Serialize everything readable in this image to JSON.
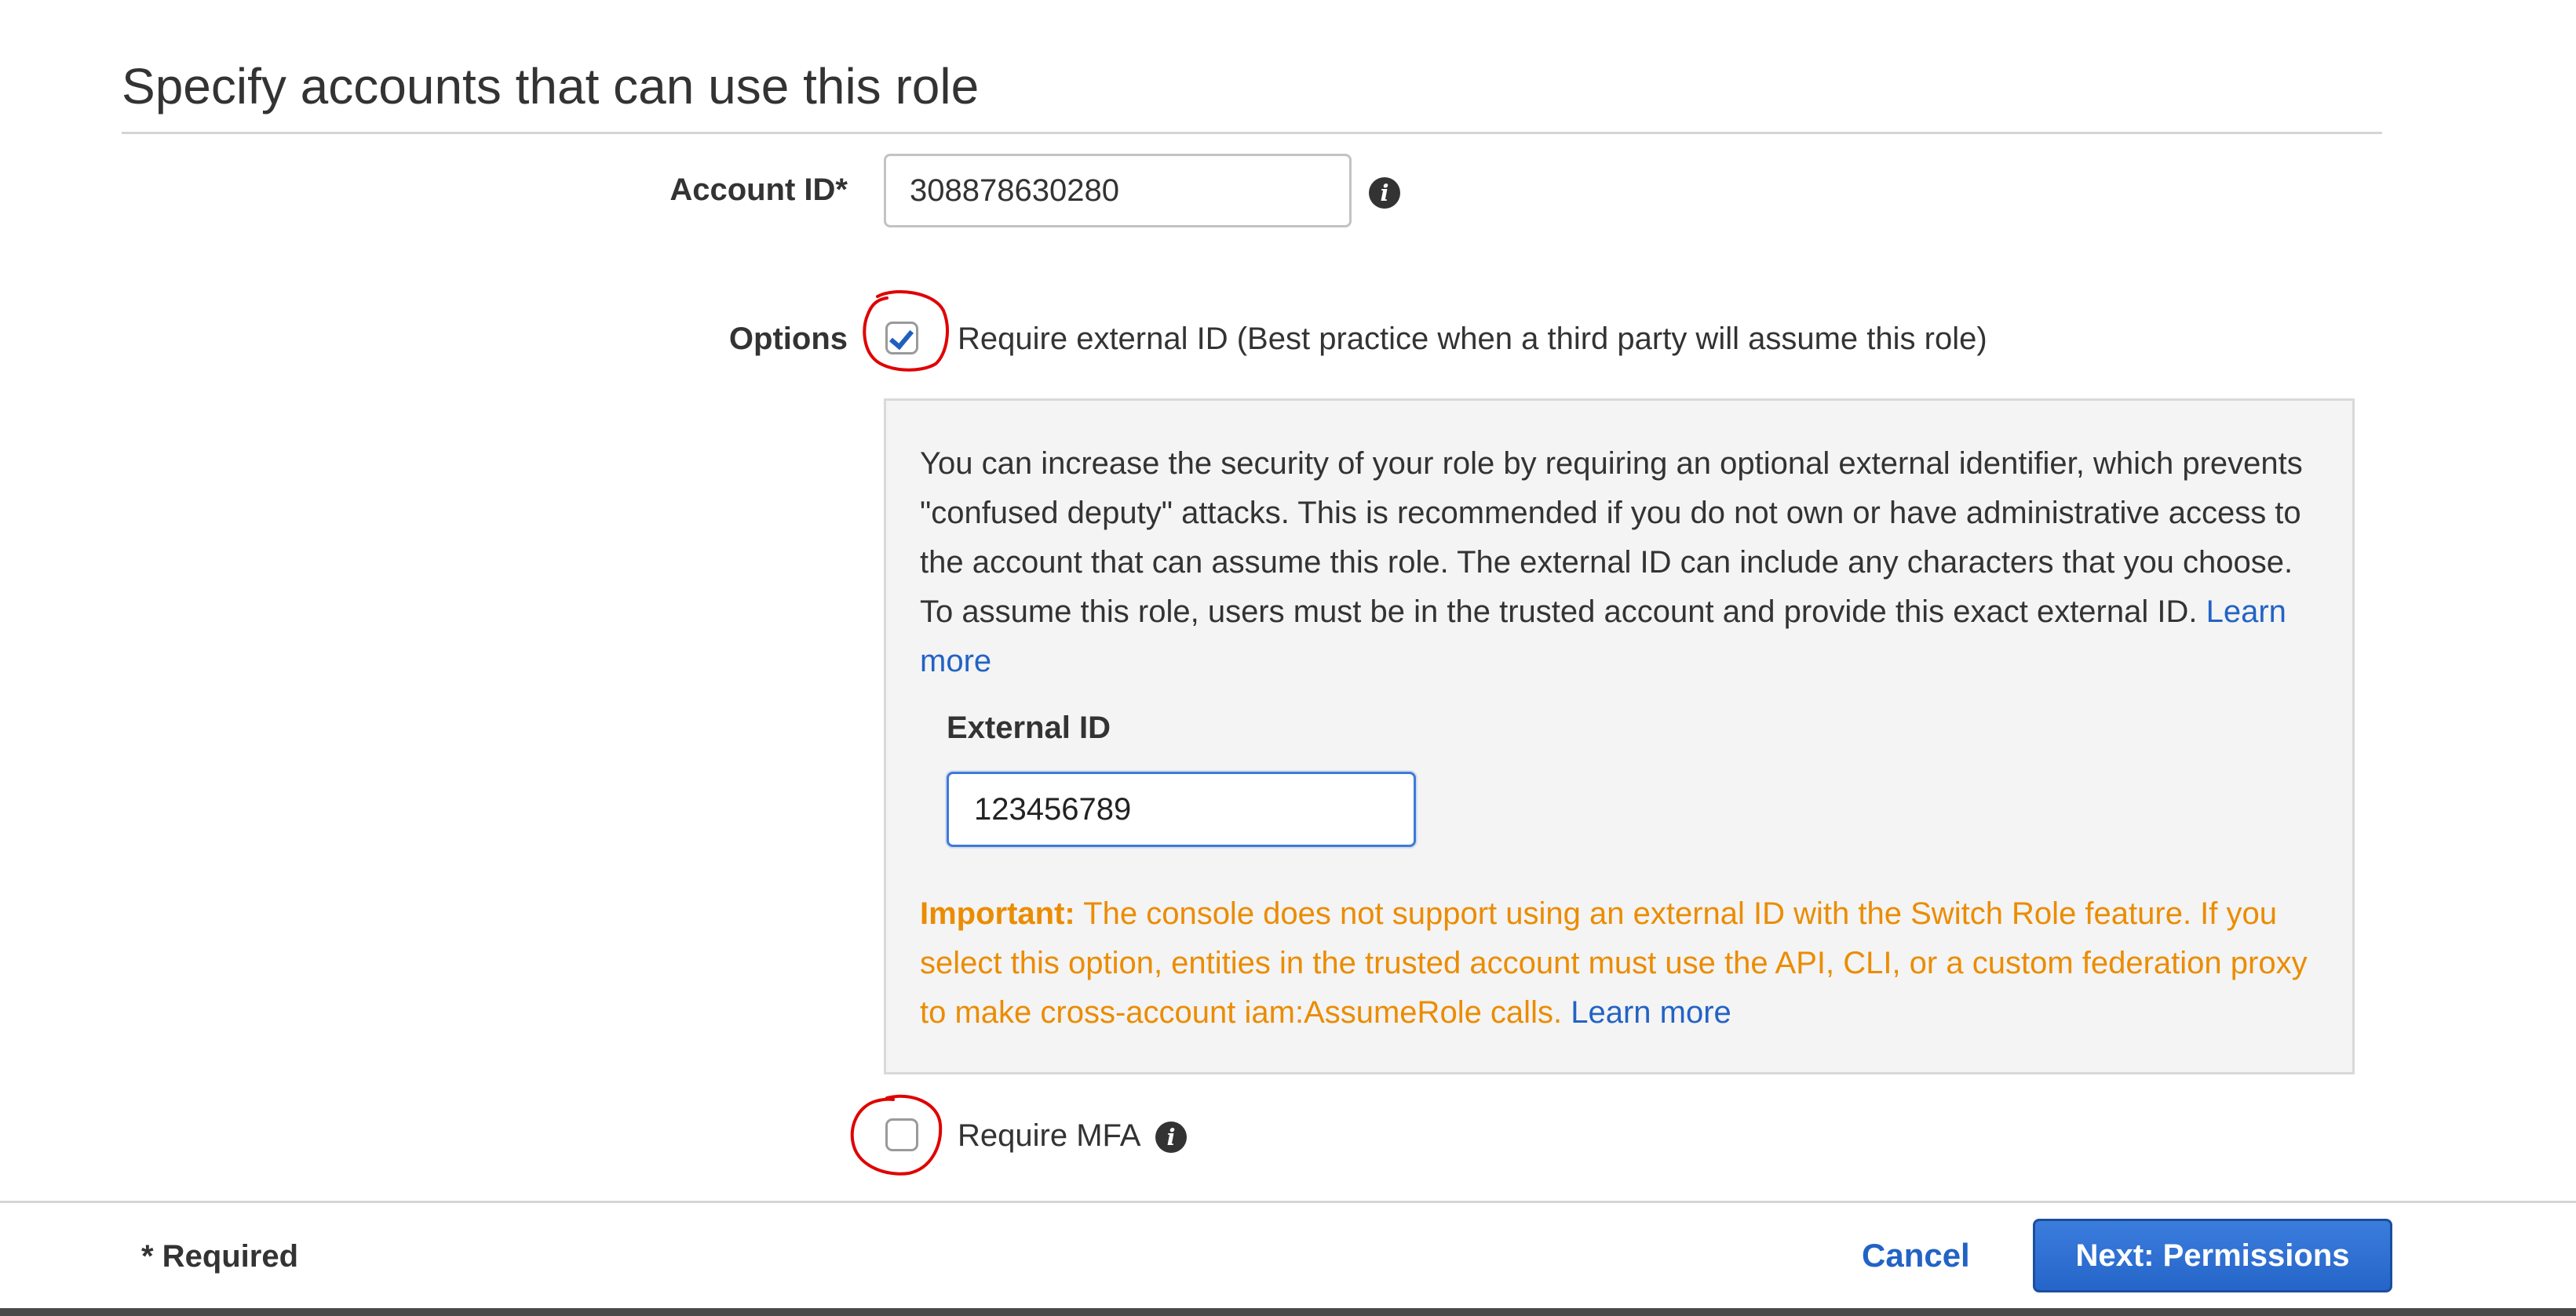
{
  "section": {
    "title": "Specify accounts that can use this role"
  },
  "account": {
    "label": "Account ID*",
    "value": "308878630280",
    "info_icon": "info-icon"
  },
  "options": {
    "label": "Options",
    "require_external_id": {
      "checked": true,
      "label": "Require external ID (Best practice when a third party will assume this role)"
    },
    "require_mfa": {
      "checked": false,
      "label": "Require MFA",
      "info_icon": "info-icon"
    }
  },
  "panel": {
    "description": "You can increase the security of your role by requiring an optional external identifier, which prevents \"confused deputy\" attacks. This is recommended if you do not own or have administrative access to the account that can assume this role. The external ID can include any characters that you choose. To assume this role, users must be in the trusted account and provide this exact external ID.",
    "learn_more": "Learn more",
    "external_id_label": "External ID",
    "external_id_value": "123456789",
    "important_label": "Important:",
    "important_text": "The console does not support using an external ID with the Switch Role feature. If you select this option, entities in the trusted account must use the API, CLI, or a custom federation proxy to make cross-account iam:AssumeRole calls.",
    "important_learn_more": "Learn more"
  },
  "footer": {
    "required_note": "* Required",
    "cancel_label": "Cancel",
    "next_label": "Next: Permissions"
  },
  "colors": {
    "link": "#2263c5",
    "warning": "#eb8c00",
    "primary_button": "#2565c9",
    "annotation": "#e00000"
  }
}
